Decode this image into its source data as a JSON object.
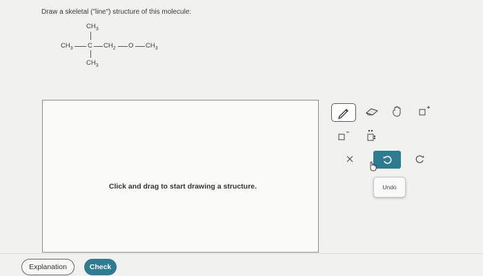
{
  "question": "Draw a skeletal (\"line\") structure of this molecule:",
  "molecule": {
    "top_group": "CH",
    "top_sub": "3",
    "left_group": "CH",
    "left_sub": "3",
    "center_atom": "C",
    "ch2": "CH",
    "ch2_sub": "2",
    "oxygen": "O",
    "right_group": "CH",
    "right_sub": "3",
    "bottom_group": "CH",
    "bottom_sub": "3"
  },
  "canvas": {
    "hint": "Click and drag to start drawing a structure."
  },
  "toolbar": {
    "tools": [
      "pencil-icon",
      "eraser-icon",
      "grab-hand-icon",
      "add-charge-icon",
      "remove-charge-icon",
      "lone-pair-icon",
      "clear-icon",
      "undo-icon",
      "redo-icon"
    ],
    "undo_tooltip": "Undo"
  },
  "buttons": {
    "explanation": "Explanation",
    "check": "Check"
  },
  "colors": {
    "accent": "#2f7b8f",
    "background": "#f1f1ef"
  }
}
